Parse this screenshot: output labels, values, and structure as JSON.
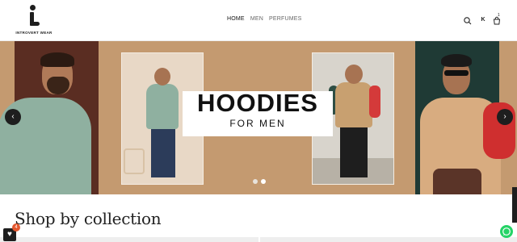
{
  "header": {
    "logo_text": "INTROVERT WEAR",
    "nav": [
      {
        "label": "HOME",
        "active": true
      },
      {
        "label": "MEN",
        "active": false
      },
      {
        "label": "PERFUMES",
        "active": false
      }
    ],
    "account_label": "K",
    "cart_count": "1",
    "icons": [
      "search-icon",
      "account-icon",
      "cart-icon"
    ]
  },
  "hero": {
    "title": "HOODIES",
    "subtitle": "FOR MEN",
    "prev_icon": "‹",
    "next_icon": "›",
    "slides_total": 2,
    "active_slide": 2,
    "background": "#c49a70"
  },
  "collection": {
    "heading": "Shop by collection"
  },
  "floating": {
    "wishlist_count": "4",
    "icons": [
      "heart-icon",
      "whatsapp-icon"
    ]
  },
  "colors": {
    "accent": "#1e1e1e",
    "badge": "#e4572e",
    "whatsapp": "#25d366"
  }
}
